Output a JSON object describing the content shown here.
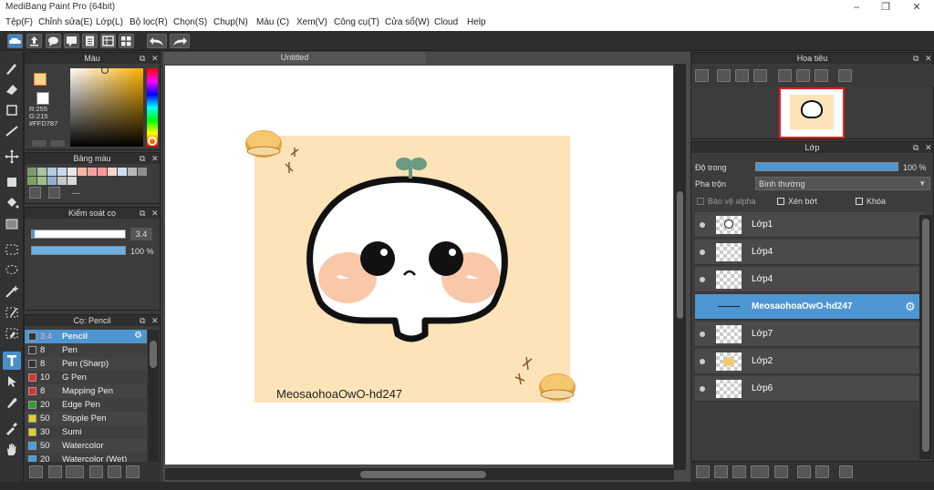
{
  "window": {
    "title": "MediBang Paint Pro (64bit)",
    "controls": [
      "–",
      "❐",
      "✕"
    ]
  },
  "menu": [
    "Tệp(F)",
    "Chỉnh sửa(E)",
    "Lớp(L)",
    "Bộ lọc(R)",
    "Chọn(S)",
    "Chụp(N)",
    "Màu (C)",
    "Xem(V)",
    "Công cụ(T)",
    "Cửa sổ(W)",
    "Cloud",
    "Help"
  ],
  "document": {
    "tab_title": "Untitled"
  },
  "color_panel": {
    "title": "Màu",
    "r": "R:255",
    "g": "G:215",
    "hex": "#FFD787",
    "primary": "#ffd787",
    "secondary": "#ffffff"
  },
  "palette_panel": {
    "title": "Bảng màu",
    "swatches_row1": [
      "#7d9a6e",
      "#a8c3a0",
      "#b7cbe0",
      "#c9d9ea",
      "#e8e8e8",
      "#f5b7a8",
      "#f4a0a0",
      "#ff9999",
      "#f7d6c9",
      "#cce0ee",
      "#b9b9b9",
      "#8e8e8e"
    ],
    "swatches_row2": [
      "#7aa35d",
      "#9ec08d",
      "#8fb0d4",
      "#c8c8c8",
      "#d8d8d8"
    ],
    "value": "---"
  },
  "brush_control": {
    "title": "Kiểm soát cọ",
    "size": "3.4",
    "opacity": "100 %",
    "size_level": 0.03,
    "opacity_level": 1.0
  },
  "brush_list": {
    "title": "Cọ: Pencil",
    "items": [
      {
        "size": "3.4",
        "name": "Pencil",
        "color": "#333333",
        "selected": true
      },
      {
        "size": "8",
        "name": "Pen",
        "color": "#333333"
      },
      {
        "size": "8",
        "name": "Pen (Sharp)",
        "color": "#333333"
      },
      {
        "size": "10",
        "name": "G Pen",
        "color": "#e03030"
      },
      {
        "size": "8",
        "name": "Mapping Pen",
        "color": "#e03030"
      },
      {
        "size": "20",
        "name": "Edge Pen",
        "color": "#30a030"
      },
      {
        "size": "50",
        "name": "Stipple Pen",
        "color": "#e0d020"
      },
      {
        "size": "30",
        "name": "Sumi",
        "color": "#e0d020"
      },
      {
        "size": "50",
        "name": "Watercolor",
        "color": "#40a0e0"
      },
      {
        "size": "20",
        "name": "Watercolor (Wet)",
        "color": "#40a0e0"
      }
    ]
  },
  "navigator": {
    "title": "Hoa tiêu"
  },
  "layers_panel": {
    "title": "Lớp",
    "opacity_label": "Độ trong",
    "opacity_value": "100 %",
    "opacity_level": 1.0,
    "blend_label": "Pha trộn",
    "blend_value": "Bình thường",
    "protect_alpha": "Bảo vệ alpha",
    "clipping": "Xén bớt",
    "lock": "Khóa",
    "layers": [
      {
        "name": "Lớp1",
        "thumb": "face"
      },
      {
        "name": "Lớp4",
        "thumb": "empty"
      },
      {
        "name": "Lớp4",
        "thumb": "empty"
      },
      {
        "name": "MeosaohoaOwO-hd247",
        "thumb": "line",
        "selected": true
      },
      {
        "name": "Lớp7",
        "thumb": "empty"
      },
      {
        "name": "Lớp2",
        "thumb": "cake"
      },
      {
        "name": "Lớp6",
        "thumb": "empty"
      }
    ]
  },
  "artwork": {
    "caption": "MeosaohoaOwO-hd247",
    "bg_color": "#fde3b8",
    "blush_color": "#f9c8a8",
    "sprout_color": "#6a9a80"
  }
}
